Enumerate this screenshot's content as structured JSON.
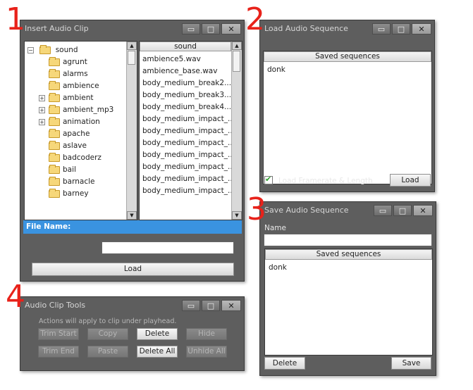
{
  "annotations": [
    "1",
    "2",
    "3",
    "4"
  ],
  "insert_clip": {
    "title": "Insert Audio Clip",
    "win_buttons": {
      "minimize": "▭",
      "maximize": "□",
      "close": "✕"
    },
    "tree": {
      "root": "sound",
      "root_expander": "−",
      "items": [
        {
          "label": "agrunt",
          "expander": ""
        },
        {
          "label": "alarms",
          "expander": ""
        },
        {
          "label": "ambience",
          "expander": ""
        },
        {
          "label": "ambient",
          "expander": "+"
        },
        {
          "label": "ambient_mp3",
          "expander": "+"
        },
        {
          "label": "animation",
          "expander": "+"
        },
        {
          "label": "apache",
          "expander": ""
        },
        {
          "label": "aslave",
          "expander": ""
        },
        {
          "label": "badcoderz",
          "expander": ""
        },
        {
          "label": "bail",
          "expander": ""
        },
        {
          "label": "barnacle",
          "expander": ""
        },
        {
          "label": "barney",
          "expander": ""
        }
      ]
    },
    "files_header": "sound",
    "files": [
      "ambience5.wav",
      "ambience_base.wav",
      "body_medium_break2....",
      "body_medium_break3....",
      "body_medium_break4....",
      "body_medium_impact_...",
      "body_medium_impact_...",
      "body_medium_impact_...",
      "body_medium_impact_...",
      "body_medium_impact_...",
      "body_medium_impact_...",
      "body_medium_impact_..."
    ],
    "file_name_label": "File Name:",
    "file_name_value": "",
    "load_label": "Load",
    "colors": {
      "file_name_bar": "#3a93e0"
    }
  },
  "load_sequence": {
    "title": "Load Audio Sequence",
    "header": "Saved sequences",
    "items": [
      "donk"
    ],
    "checkbox_label": "Load Framerate & Length",
    "checkbox_checked": true,
    "load_label": "Load"
  },
  "save_sequence": {
    "title": "Save Audio Sequence",
    "name_label": "Name",
    "name_value": "",
    "header": "Saved sequences",
    "items": [
      "donk"
    ],
    "delete_label": "Delete",
    "save_label": "Save"
  },
  "clip_tools": {
    "title": "Audio Clip Tools",
    "hint": "Actions will apply to clip under playhead.",
    "buttons": {
      "trim_start": "Trim Start",
      "copy": "Copy",
      "delete": "Delete",
      "hide": "Hide",
      "trim_end": "Trim End",
      "paste": "Paste",
      "delete_all": "Delete All",
      "unhide_all": "Unhide All"
    }
  },
  "colors": {
    "annotation": "#e8221a",
    "panel": "#5e5e5e"
  }
}
